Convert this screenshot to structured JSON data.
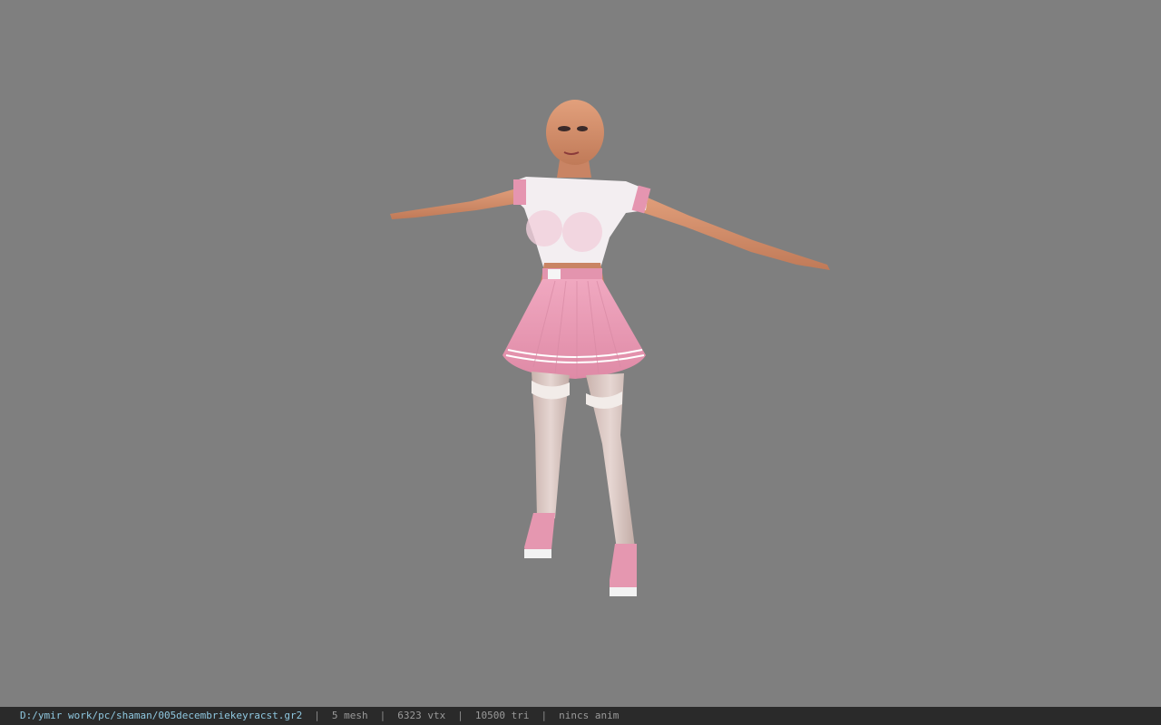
{
  "viewer": {
    "background_color": "#7f7f7f",
    "model_subject": "female character model in T-pose",
    "outfit_colors": {
      "skin": "#d7916d",
      "top": "#f4eef2",
      "skirt": "#e89bb4",
      "stockings": "#d8c8c4",
      "shoes": "#e597b0"
    }
  },
  "status": {
    "file_path": "D:/ymir work/pc/shaman/005decembriekeyracst.gr2",
    "separator": "|",
    "mesh": "5 mesh",
    "vertices": "6323 vtx",
    "triangles": "10500 tri",
    "anim": "nincs anim"
  }
}
